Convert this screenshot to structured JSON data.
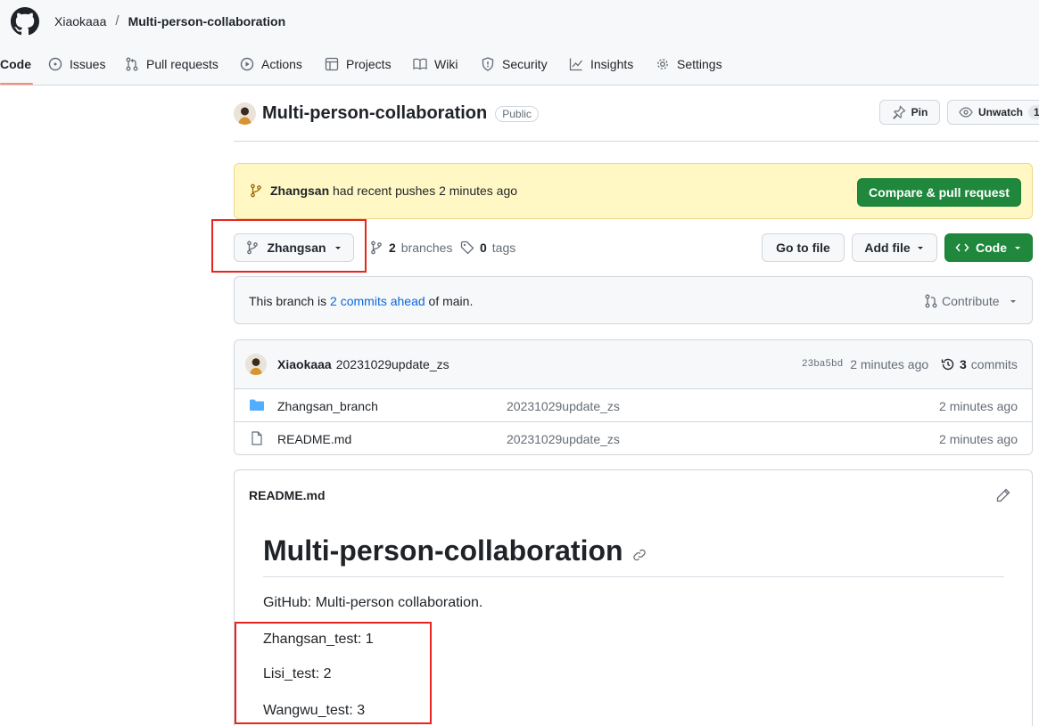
{
  "header": {
    "owner": "Xiaokaaa",
    "separator": "/",
    "repo": "Multi-person-collaboration"
  },
  "nav": {
    "tabs": [
      {
        "label": "Code",
        "icon": "code-icon",
        "active": true
      },
      {
        "label": "Issues",
        "icon": "issue-icon"
      },
      {
        "label": "Pull requests",
        "icon": "pull-request-icon"
      },
      {
        "label": "Actions",
        "icon": "play-icon"
      },
      {
        "label": "Projects",
        "icon": "table-icon"
      },
      {
        "label": "Wiki",
        "icon": "book-icon"
      },
      {
        "label": "Security",
        "icon": "shield-icon"
      },
      {
        "label": "Insights",
        "icon": "graph-icon"
      },
      {
        "label": "Settings",
        "icon": "gear-icon"
      }
    ]
  },
  "repo": {
    "title": "Multi-person-collaboration",
    "visibility": "Public",
    "pin_label": "Pin",
    "unwatch_label": "Unwatch",
    "watch_count": "1"
  },
  "banner": {
    "branch": "Zhangsan",
    "message": "had recent pushes 2 minutes ago",
    "compare_label": "Compare & pull request"
  },
  "toolbar": {
    "branch": "Zhangsan",
    "branch_count": "2",
    "branches_label": "branches",
    "tag_count": "0",
    "tags_label": "tags",
    "go_to_file": "Go to file",
    "add_file": "Add file",
    "code": "Code"
  },
  "branch_info": {
    "prefix": "This branch is",
    "link": "2 commits ahead",
    "suffix": "of main.",
    "contribute": "Contribute"
  },
  "latest_commit": {
    "author": "Xiaokaaa",
    "message": "20231029update_zs",
    "sha": "23ba5bd",
    "time": "2 minutes ago",
    "commit_count": "3",
    "commits_label": "commits"
  },
  "files": [
    {
      "type": "folder",
      "name": "Zhangsan_branch",
      "message": "20231029update_zs",
      "time": "2 minutes ago"
    },
    {
      "type": "file",
      "name": "README.md",
      "message": "20231029update_zs",
      "time": "2 minutes ago"
    }
  ],
  "readme": {
    "filename": "README.md",
    "heading": "Multi-person-collaboration",
    "intro": "GitHub: Multi-person collaboration.",
    "lines": [
      "Zhangsan_test: 1",
      "Lisi_test: 2",
      "Wangwu_test: 3"
    ]
  },
  "colors": {
    "accent_underline": "#fd8c73",
    "green_button": "#1f883d",
    "banner_bg": "#fff8c5",
    "highlight_red": "#e5251e",
    "link": "#0969da"
  }
}
